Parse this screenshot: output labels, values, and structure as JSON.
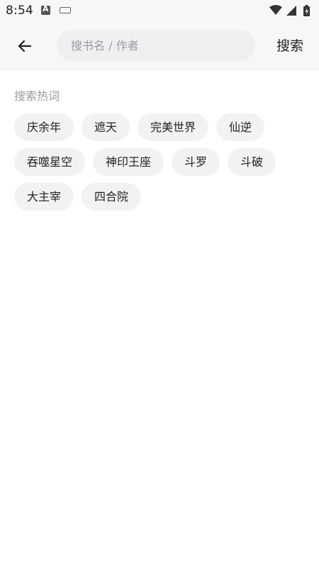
{
  "status_bar": {
    "time": "8:54",
    "icons": [
      "a-notification-icon",
      "keyboard-icon",
      "wifi-icon",
      "signal-icon",
      "battery-icon"
    ]
  },
  "header": {
    "back_icon": "arrow-left-icon",
    "search_placeholder": "搜书名 / 作者",
    "search_value": "",
    "search_button_label": "搜索"
  },
  "hot_searches": {
    "title": "搜索热词",
    "tags": [
      "庆余年",
      "遮天",
      "完美世界",
      "仙逆",
      "吞噬星空",
      "神印王座",
      "斗罗",
      "斗破",
      "大主宰",
      "四合院"
    ]
  },
  "colors": {
    "header_background": "#f7f7f8",
    "search_box_background": "#efeff1",
    "tag_background": "#f2f2f4",
    "section_title": "#9a9aa0"
  }
}
